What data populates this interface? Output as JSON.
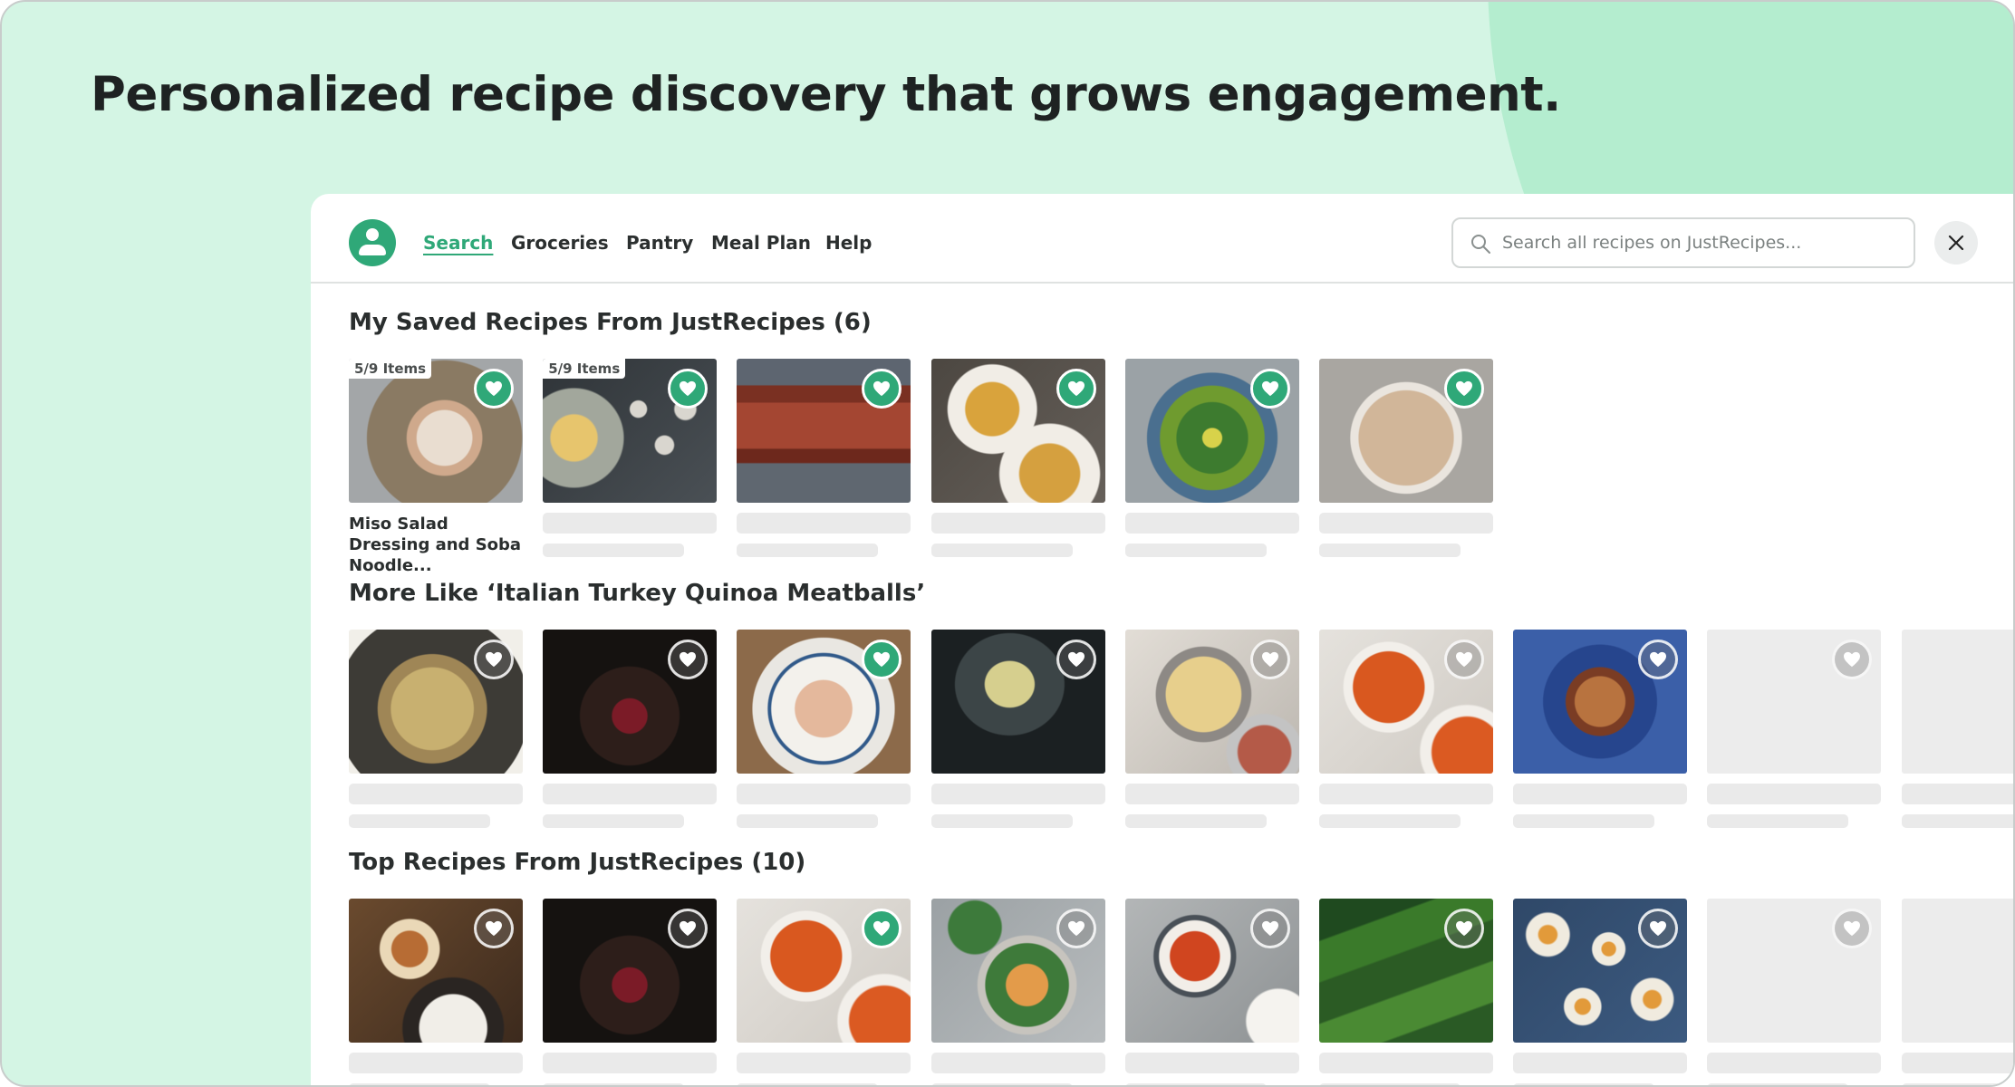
{
  "headline": "Personalized recipe discovery that grows engagement.",
  "colors": {
    "accent": "#2fa878",
    "background": "#d4f5e4",
    "blob": "#b4edcf"
  },
  "nav": {
    "avatar_icon": "user-icon",
    "links": [
      "Search",
      "Groceries",
      "Pantry",
      "Meal Plan",
      "Help"
    ],
    "active": "Search"
  },
  "search": {
    "placeholder": "Search all recipes on JustRecipes..."
  },
  "close_icon": "close-icon",
  "sections": [
    {
      "title": "My Saved Recipes From JustRecipes (6)",
      "cards": [
        {
          "badge": "5/9 Items",
          "title": "Miso Salad Dressing and Soba Noodle...",
          "favorited": true,
          "image": "noodles"
        },
        {
          "badge": "5/9 Items",
          "favorited": true,
          "image": "dumplings"
        },
        {
          "favorited": true,
          "image": "roast-meat"
        },
        {
          "favorited": true,
          "image": "curry-bowls"
        },
        {
          "favorited": true,
          "image": "egg-salad"
        },
        {
          "favorited": true,
          "image": "hummus"
        }
      ]
    },
    {
      "title": "More Like ‘Italian Turkey Quinoa Meatballs’",
      "cards": [
        {
          "favorited": false,
          "image": "pot-pie"
        },
        {
          "favorited": false,
          "image": "red-drink"
        },
        {
          "favorited": true,
          "image": "ravioli"
        },
        {
          "favorited": false,
          "image": "cocktail"
        },
        {
          "favorited": false,
          "image": "pasta-pan"
        },
        {
          "favorited": false,
          "image": "clam-stew"
        },
        {
          "favorited": false,
          "image": "nuts-bowl"
        },
        {
          "favorited": false,
          "image": "empty"
        },
        {
          "favorited": false,
          "image": "empty"
        }
      ]
    },
    {
      "title": "Top Recipes From JustRecipes (10)",
      "cards": [
        {
          "favorited": false,
          "image": "spice-board"
        },
        {
          "favorited": false,
          "image": "red-drink"
        },
        {
          "favorited": true,
          "image": "clam-stew"
        },
        {
          "favorited": false,
          "image": "shrimp-salad"
        },
        {
          "favorited": false,
          "image": "tomato-rice"
        },
        {
          "favorited": false,
          "image": "broccolini"
        },
        {
          "favorited": false,
          "image": "deviled-eggs"
        },
        {
          "favorited": false,
          "image": "empty"
        },
        {
          "favorited": false,
          "image": "empty"
        }
      ]
    }
  ]
}
